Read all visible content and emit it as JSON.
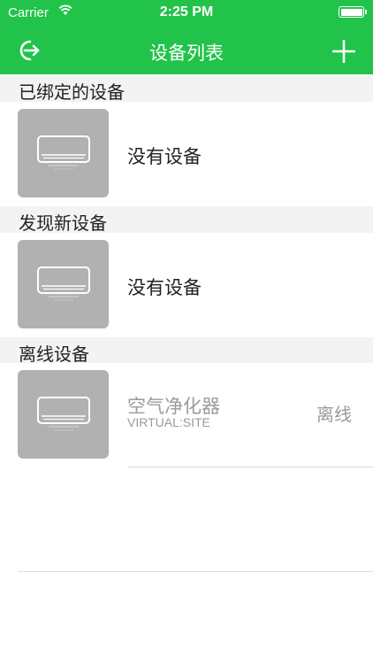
{
  "status_bar": {
    "carrier": "Carrier",
    "time": "2:25 PM",
    "battery": 1.0
  },
  "nav": {
    "title": "设备列表",
    "back_icon": "logout-arrow-icon",
    "add_icon": "plus-icon"
  },
  "sections": [
    {
      "title": "已绑定的设备",
      "rows": [
        {
          "text": "没有设备",
          "icon": "air-conditioner-icon"
        }
      ]
    },
    {
      "title": "发现新设备",
      "rows": [
        {
          "text": "没有设备",
          "icon": "air-conditioner-icon"
        }
      ]
    },
    {
      "title": "离线设备",
      "rows": [
        {
          "name": "空气净化器",
          "subtitle": "VIRTUAL:SITE",
          "status": "离线",
          "icon": "air-conditioner-icon"
        }
      ]
    }
  ],
  "colors": {
    "header": "#22c34a",
    "section_bg": "#f3f3f3",
    "thumb_bg": "#b1b1b1",
    "muted_text": "#9a9a9a"
  }
}
